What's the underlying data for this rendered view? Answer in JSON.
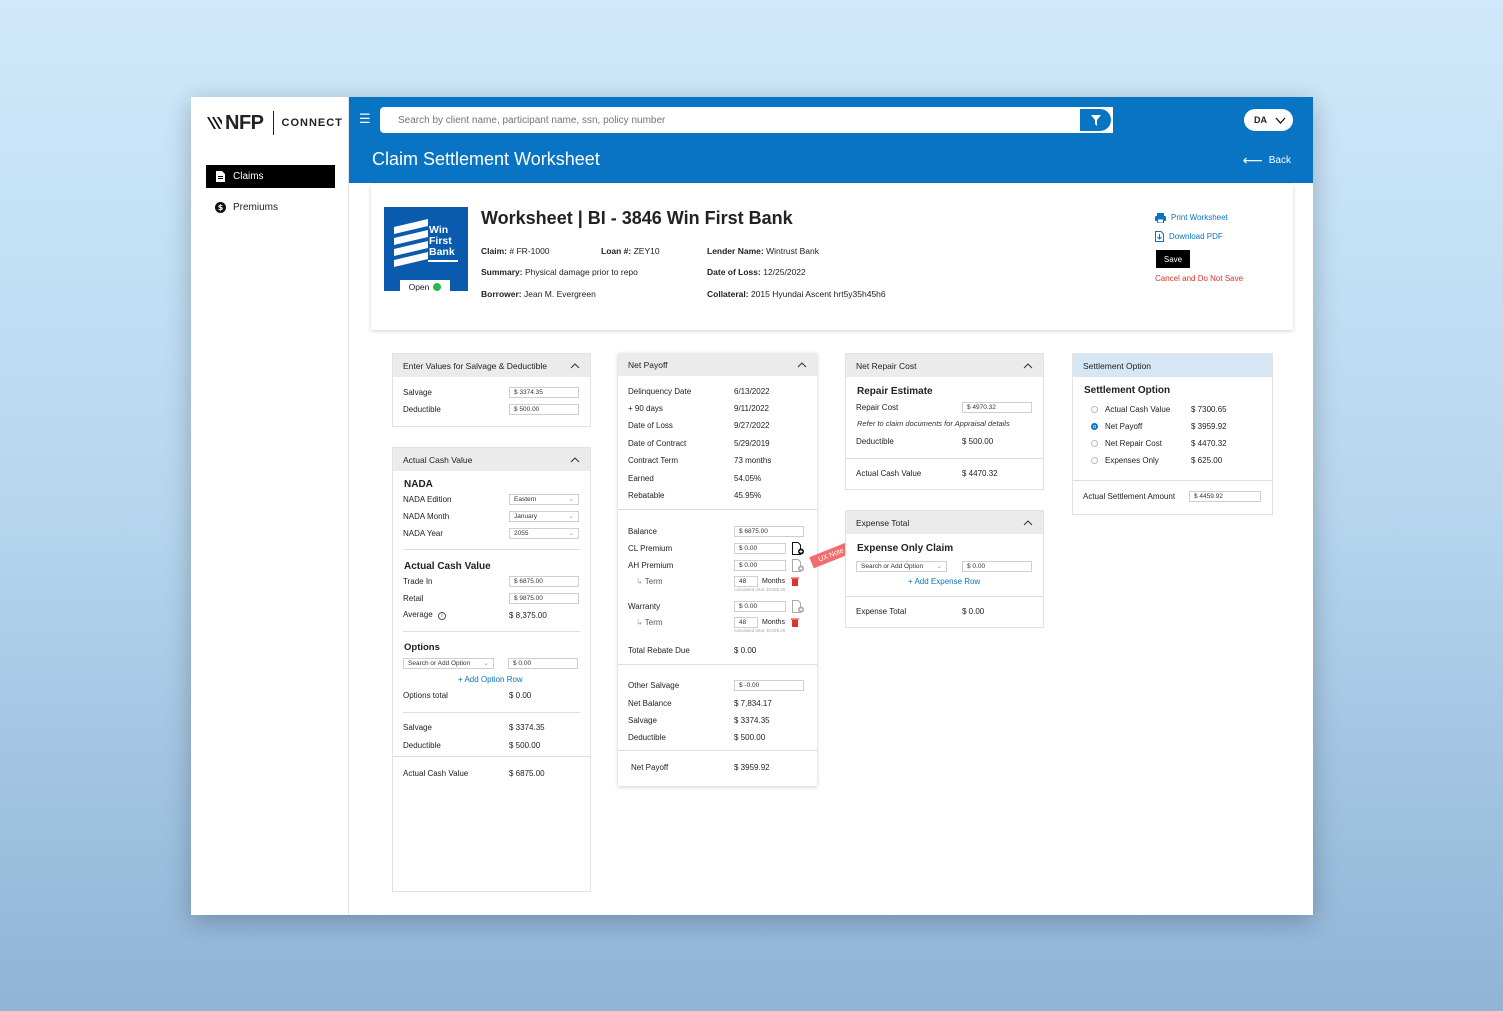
{
  "app": {
    "brand": "NFP",
    "product": "CONNECT"
  },
  "sidebar": {
    "items": [
      {
        "label": "Claims",
        "icon": "document-icon",
        "active": true
      },
      {
        "label": "Premiums",
        "icon": "dollar-circle-icon",
        "active": false
      }
    ]
  },
  "topbar": {
    "search_placeholder": "Search by client name, participant name, ssn, policy number",
    "user_initials": "DA",
    "page_title": "Claim Settlement Worksheet",
    "back_label": "Back"
  },
  "header": {
    "bank_logo_text": [
      "Win",
      "First",
      "Bank"
    ],
    "status": "Open",
    "title": "Worksheet | BI - 3846 Win First Bank",
    "claim_label": "Claim:",
    "claim_value": "# FR-1000",
    "loan_label": "Loan #:",
    "loan_value": "ZEY10",
    "lender_label": "Lender Name:",
    "lender_value": "Wintrust Bank",
    "summary_label": "Summary:",
    "summary_value": "Physical damage prior to repo",
    "date_of_loss_label": "Date of Loss:",
    "date_of_loss_value": "12/25/2022",
    "borrower_label": "Borrower:",
    "borrower_value": "Jean M. Evergreen",
    "collateral_label": "Collateral:",
    "collateral_value": "2015 Hyundai Ascent hrt5y35h45h6",
    "print_label": "Print Worksheet",
    "download_label": "Download PDF",
    "save_label": "Save",
    "cancel_label": "Cancel and Do Not Save"
  },
  "salvage_panel": {
    "title": "Enter Values for Salvage & Deductible",
    "salvage_label": "Salvage",
    "salvage_value": "$ 3374.35",
    "deductible_label": "Deductible",
    "deductible_value": "$ 500.00"
  },
  "acv_panel": {
    "title": "Actual Cash Value",
    "nada_title": "NADA",
    "nada_edition_label": "NADA Edition",
    "nada_edition_value": "Eastern",
    "nada_month_label": "NADA Month",
    "nada_month_value": "January",
    "nada_year_label": "NADA Year",
    "nada_year_value": "2055",
    "acv_title": "Actual Cash Value",
    "trade_in_label": "Trade In",
    "trade_in_value": "$ 6875.00",
    "retail_label": "Retail",
    "retail_value": "$ 9875.00",
    "average_label": "Average",
    "average_value": "$ 8,375.00",
    "options_title": "Options",
    "option_select": "Search or Add Option",
    "option_value": "$ 0.00",
    "add_option_label": "+ Add Option Row",
    "options_total_label": "Options total",
    "options_total_value": "$ 0.00",
    "salvage_label": "Salvage",
    "salvage_value": "$ 3374.35",
    "deductible_label": "Deductible",
    "deductible_value": "$ 500.00",
    "footer_label": "Actual Cash Value",
    "footer_value": "$ 6875.00"
  },
  "net_payoff_panel": {
    "title": "Net Payoff",
    "rows": [
      {
        "label": "Delinquency Date",
        "value": "6/13/2022"
      },
      {
        "label": "+ 90 days",
        "value": "9/11/2022"
      },
      {
        "label": "Date of Loss",
        "value": "9/27/2022"
      },
      {
        "label": "Date of Contract",
        "value": "5/29/2019"
      },
      {
        "label": "Contract Term",
        "value": "73 months"
      },
      {
        "label": "Earned",
        "value": "54.05%"
      },
      {
        "label": "Rebatable",
        "value": "45.95%"
      }
    ],
    "balance_label": "Balance",
    "balance_value": "$ 6875.00",
    "cl_label": "CL Premium",
    "cl_value": "$ 0.00",
    "ah_label": "AH Premium",
    "ah_value": "$ 0.00",
    "term_label": "Term",
    "term_value": "48",
    "months_label": "Months",
    "calc_note": "calculated total: $3459.28",
    "warranty_label": "Warranty",
    "warranty_value": "$ 0.00",
    "term2_label": "Term",
    "term2_value": "48",
    "months2_label": "Months",
    "calc_note2": "calculated total: $3459.28",
    "total_rebate_label": "Total Rebate Due",
    "total_rebate_value": "$ 0.00",
    "other_salvage_label": "Other Salvage",
    "other_salvage_value": "$ -0.00",
    "net_balance_label": "Net Balance",
    "net_balance_value": "$ 7,834.17",
    "salvage_label": "Salvage",
    "salvage_value": "$ 3374.35",
    "deductible_label": "Deductible",
    "deductible_value": "$ 500.00",
    "footer_label": "Net Payoff",
    "footer_value": "$ 3959.92",
    "ux_note": "UX Note"
  },
  "repair_panel": {
    "title": "Net Repair Cost",
    "estimate_title": "Repair Estimate",
    "repair_cost_label": "Repair Cost",
    "repair_cost_value": "$ 4970.32",
    "note": "Refer to claim documents for Appraisal details",
    "deductible_label": "Deductible",
    "deductible_value": "$ 500.00",
    "footer_label": "Actual Cash Value",
    "footer_value": "$ 4470.32"
  },
  "expense_panel": {
    "title": "Expense Total",
    "sub_title": "Expense Only Claim",
    "select": "Search or Add Option",
    "value": "$ 0.00",
    "add_label": "+ Add Expense Row",
    "footer_label": "Expense Total",
    "footer_value": "$ 0.00"
  },
  "settlement_panel": {
    "title": "Settlement Option",
    "sub_title": "Settlement Option",
    "options": [
      {
        "label": "Actual Cash Value",
        "value": "$ 7300.65",
        "selected": false
      },
      {
        "label": "Net Payoff",
        "value": "$ 3959.92",
        "selected": true
      },
      {
        "label": "Net Repair Cost",
        "value": "$ 4470.32",
        "selected": false
      },
      {
        "label": "Expenses Only",
        "value": "$ 625.00",
        "selected": false
      }
    ],
    "amount_label": "Actual Settlement Amount",
    "amount_value": "$ 4459.92"
  },
  "colors": {
    "brand_blue": "#0a74c4",
    "bank_blue": "#0a5bad",
    "status_green": "#2bb84a",
    "cancel_red": "#e0322b",
    "trash_red": "#e0322b"
  }
}
